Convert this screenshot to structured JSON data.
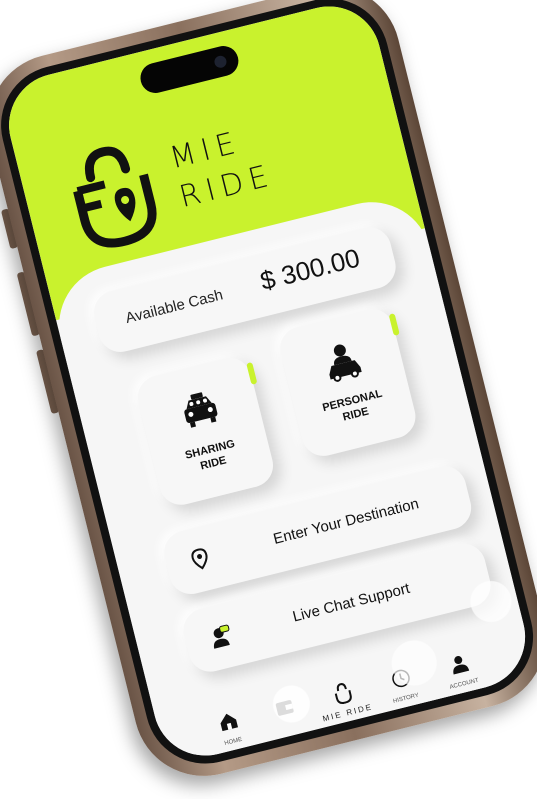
{
  "app": {
    "brand_line1": "MIE",
    "brand_line2": "RIDE"
  },
  "wallet": {
    "label": "Available Cash",
    "amount": "$ 300.00"
  },
  "tiles": {
    "sharing": {
      "line1": "SHARING",
      "line2": "RIDE",
      "icon": "taxi-icon"
    },
    "personal": {
      "line1": "PERSONAL",
      "line2": "RIDE",
      "icon": "driver-car-icon"
    }
  },
  "actions": {
    "destination": "Enter Your Destination",
    "chat": "Live Chat Support"
  },
  "nav": {
    "home": "HOME",
    "wallet": "",
    "brand": "MIE RIDE",
    "history": "HISTORY",
    "account": "ACCOUNT"
  },
  "colors": {
    "accent": "#c9f22d",
    "background": "#f6f6f6",
    "text": "#111111"
  }
}
